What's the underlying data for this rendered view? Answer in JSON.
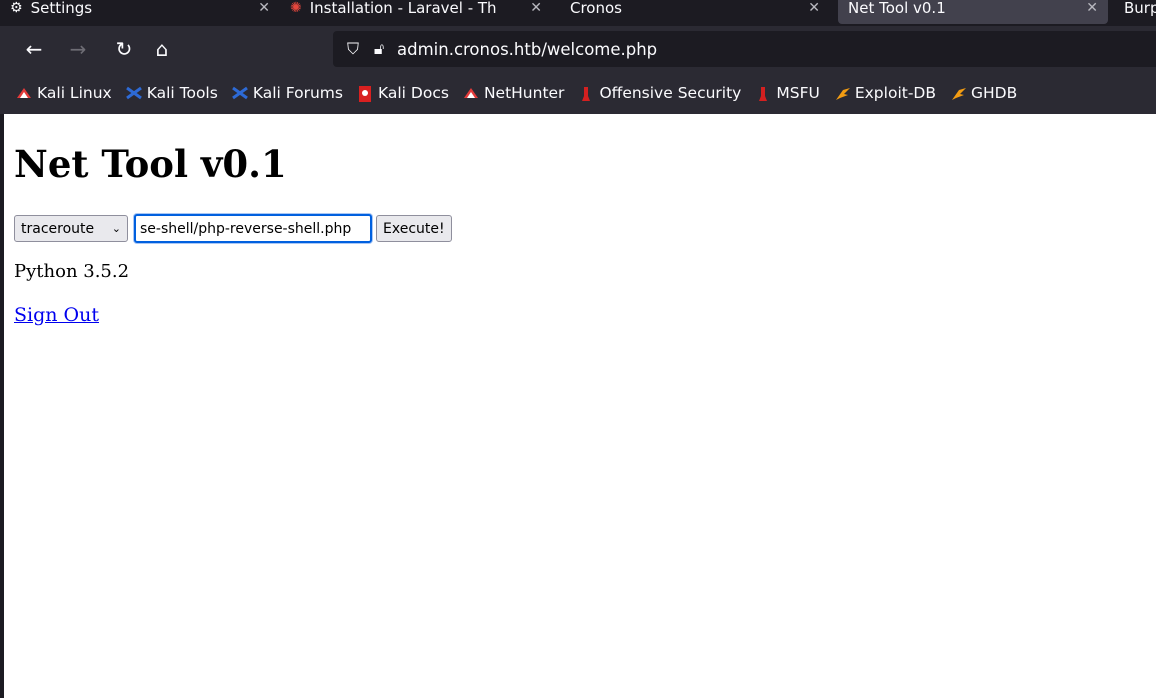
{
  "tabs": [
    {
      "label": "Settings",
      "icon": "gear-icon"
    },
    {
      "label": "Installation - Laravel - Th",
      "icon": "laravel-icon"
    },
    {
      "label": "Cronos",
      "icon": ""
    },
    {
      "label": "Net Tool v0.1",
      "icon": ""
    },
    {
      "label": "Burp",
      "icon": ""
    }
  ],
  "navbar": {
    "back": "←",
    "forward": "→",
    "reload": "↻",
    "home": "⌂",
    "url": "admin.cronos.htb/welcome.php"
  },
  "bookmarks": [
    {
      "label": "Kali Linux",
      "color": "#e33a3a"
    },
    {
      "label": "Kali Tools",
      "color": "#2d6ad6"
    },
    {
      "label": "Kali Forums",
      "color": "#2d6ad6"
    },
    {
      "label": "Kali Docs",
      "color": "#d92020"
    },
    {
      "label": "NetHunter",
      "color": "#e33a3a"
    },
    {
      "label": "Offensive Security",
      "color": "#d42020"
    },
    {
      "label": "MSFU",
      "color": "#d42020"
    },
    {
      "label": "Exploit-DB",
      "color": "#f39c12"
    },
    {
      "label": "GHDB",
      "color": "#f39c12"
    }
  ],
  "page": {
    "title": "Net Tool v0.1",
    "command_selected": "traceroute",
    "host_value": "se-shell/php-reverse-shell.php",
    "execute_label": "Execute!",
    "output": "Python 3.5.2",
    "signout_label": "Sign Out"
  }
}
